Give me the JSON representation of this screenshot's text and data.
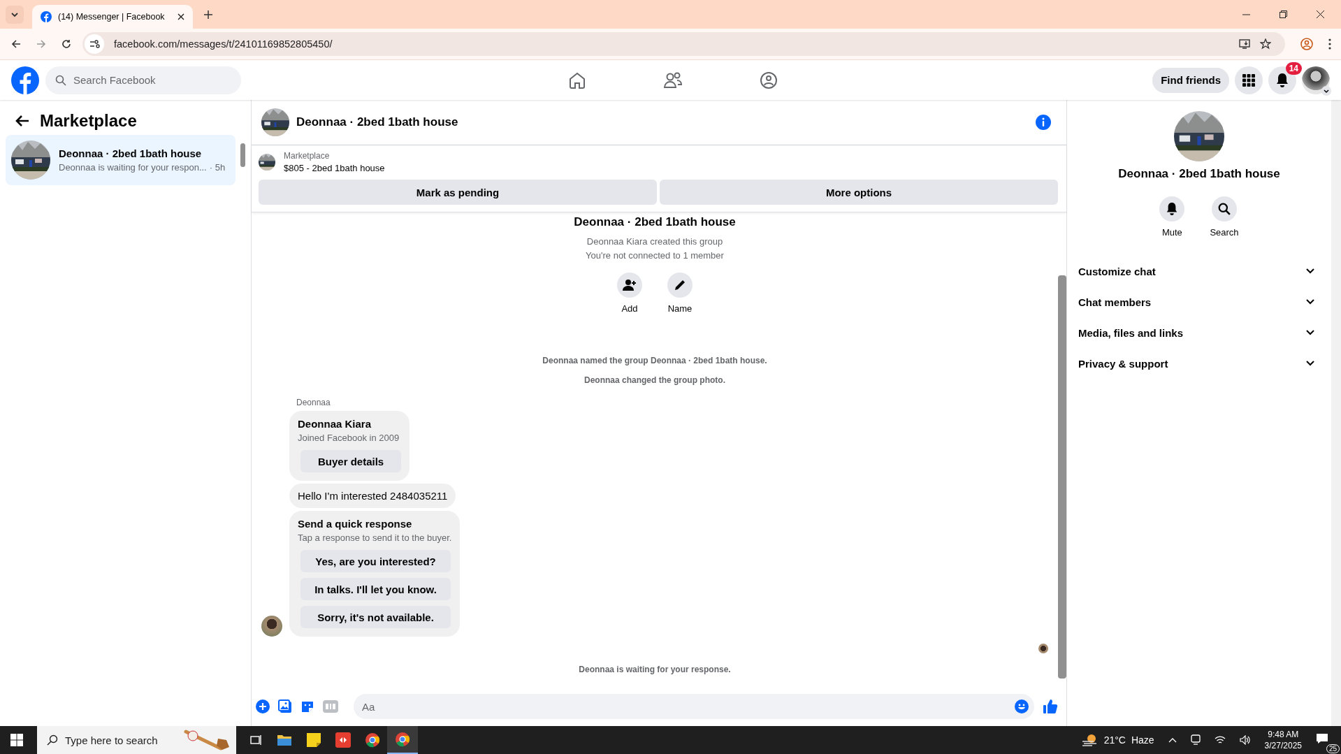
{
  "browser": {
    "tab_title": "(14) Messenger | Facebook",
    "url": "facebook.com/messages/t/24101169852805450/"
  },
  "header": {
    "search_placeholder": "Search Facebook",
    "find_friends": "Find friends",
    "notification_count": "14"
  },
  "sidebar": {
    "title": "Marketplace",
    "conversations": [
      {
        "title": "Deonnaa · 2bed 1bath house",
        "preview": "Deonnaa is waiting for your respon...",
        "time": "· 5h",
        "selected": true
      }
    ]
  },
  "chat": {
    "title": "Deonnaa · 2bed 1bath house",
    "listing": {
      "label": "Marketplace",
      "item": "$805 - 2bed 1bath house"
    },
    "actions": [
      "Mark as pending",
      "More options"
    ],
    "intro": {
      "title": "Deonnaa · 2bed 1bath house",
      "lines": [
        "Deonnaa Kiara created this group",
        "You're not connected to 1 member"
      ],
      "buttons": [
        {
          "kind": "add",
          "label": "Add"
        },
        {
          "kind": "name",
          "label": "Name"
        }
      ]
    },
    "events": [
      "Deonnaa named the group Deonnaa · 2bed 1bath house.",
      "Deonnaa changed the group photo."
    ],
    "sender": "Deonnaa",
    "profile_card": {
      "name": "Deonnaa Kiara",
      "subtitle": "Joined Facebook in 2009",
      "button": "Buyer details"
    },
    "message": "Hello I'm interested 2484035211",
    "quick_response": {
      "title": "Send a quick response",
      "subtitle": "Tap a response to send it to the buyer.",
      "options": [
        "Yes, are you interested?",
        "In talks. I'll let you know.",
        "Sorry, it's not available."
      ]
    },
    "status": "Deonnaa is waiting for your response.",
    "composer_placeholder": "Aa"
  },
  "details": {
    "title": "Deonnaa · 2bed 1bath house",
    "actions": [
      {
        "kind": "mute",
        "label": "Mute"
      },
      {
        "kind": "search",
        "label": "Search"
      }
    ],
    "sections": [
      {
        "label": "Customize chat",
        "expanded": false
      },
      {
        "label": "Chat members",
        "expanded": false
      },
      {
        "label": "Media, files and links",
        "expanded": false
      },
      {
        "label": "Privacy & support",
        "expanded": false
      }
    ]
  },
  "taskbar": {
    "search_placeholder": "Type here to search",
    "temperature": "21°C",
    "weather": "Haze",
    "time": "9:48 AM",
    "date": "3/27/2025",
    "notification_count": "25"
  }
}
